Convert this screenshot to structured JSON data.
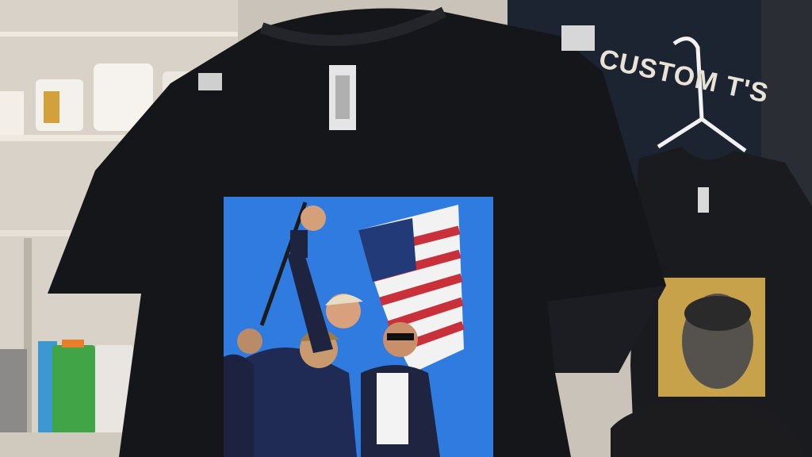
{
  "scene": {
    "description_type": "photo",
    "colors": {
      "shirt": "#15161a",
      "sky": "#2f7be0",
      "sign": "#1d2431",
      "shelf": "#d8d2c8",
      "flag_red": "#c8313a",
      "flag_blue": "#223a78"
    }
  },
  "store_sign": {
    "text": "CUSTOM T'S"
  },
  "icons": [
    "hanger-icon",
    "clip-icon"
  ]
}
